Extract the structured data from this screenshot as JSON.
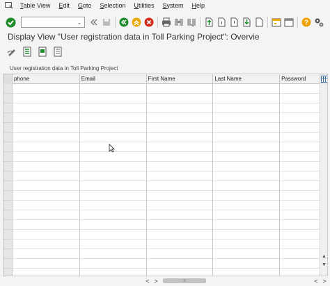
{
  "menu": {
    "items": [
      {
        "label": "Table View",
        "key": "T",
        "rest": "able View"
      },
      {
        "label": "Edit",
        "key": "E",
        "rest": "dit"
      },
      {
        "label": "Goto",
        "key": "G",
        "rest": "oto"
      },
      {
        "label": "Selection",
        "key": "S",
        "rest": "election"
      },
      {
        "label": "Utilities",
        "key": "U",
        "rest": "tilities"
      },
      {
        "label": "System",
        "key": "S",
        "rest": "ystem"
      },
      {
        "label": "Help",
        "key": "H",
        "rest": "elp"
      }
    ]
  },
  "toolbar": {
    "command_value": "",
    "colors": {
      "green": "#1e8a2a",
      "yellow": "#e8a800",
      "red": "#d42a1a",
      "orange": "#f0a000"
    }
  },
  "title": "Display View \"User registration data in Toll Parking Project\": Overvie",
  "table": {
    "caption": "User registration data in Toll Parking Project",
    "columns": [
      "phone",
      "Email",
      "First Name",
      "Last Name",
      "Password"
    ],
    "row_count": 20
  }
}
